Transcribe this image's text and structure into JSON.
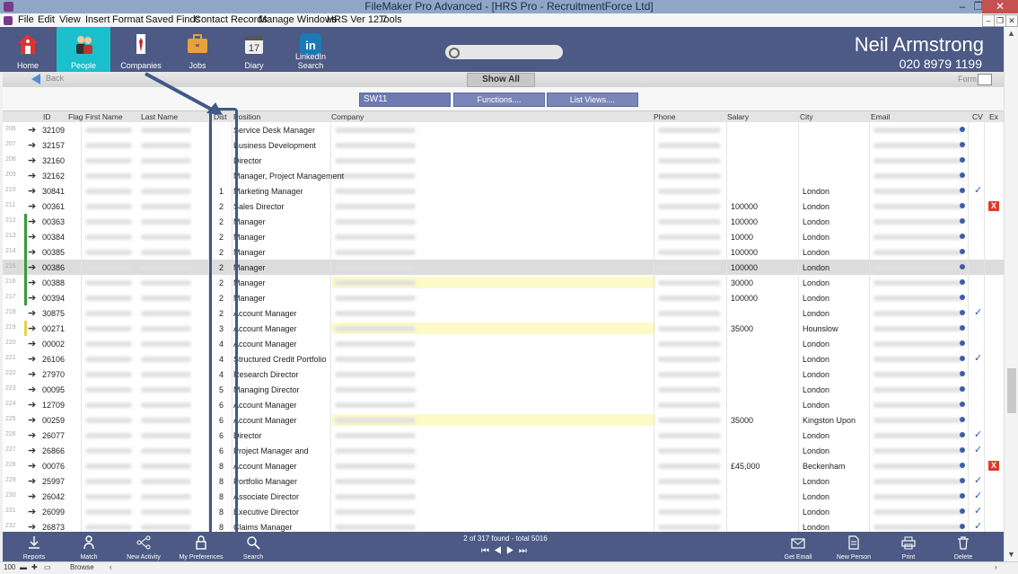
{
  "window": {
    "title": "FileMaker Pro Advanced - [HRS Pro - RecruitmentForce Ltd]",
    "controls": [
      "–",
      "❐",
      "✕"
    ]
  },
  "menu": [
    "File",
    "Edit",
    "View",
    "Insert",
    "Format",
    "Saved Finds",
    "Contact Records",
    "Manage Windows",
    "HRS Ver 12.7",
    "Tools"
  ],
  "nav": [
    {
      "label": "Home",
      "icon": "home-icon"
    },
    {
      "label": "People",
      "icon": "people-icon",
      "active": true
    },
    {
      "label": "Companies",
      "icon": "companies-icon"
    },
    {
      "label": "Jobs",
      "icon": "jobs-icon"
    },
    {
      "label": "Diary",
      "icon": "diary-icon"
    },
    {
      "label": "LinkedIn Search",
      "icon": "linkedin-icon"
    }
  ],
  "diary_day": "17",
  "user": {
    "name": "Neil Armstrong",
    "phone": "020 8979 1199"
  },
  "toolbar": {
    "back": "Back",
    "show_all": "Show All",
    "form": "Form"
  },
  "filters": {
    "sw": "SW11",
    "functions": "Functions....",
    "list_views": "List Views...."
  },
  "columns": [
    "ID",
    "Flag",
    "First Name",
    "Last Name",
    "Dist",
    "Position",
    "Company",
    "Phone",
    "Salary",
    "City",
    "Email",
    "CV",
    "Ex"
  ],
  "rows": [
    {
      "num": "206",
      "id": "32109",
      "dist": "",
      "position": "Service Desk Manager",
      "salary": "",
      "city": "",
      "cv": true,
      "check": false,
      "ex": false,
      "hl": false,
      "flag": ""
    },
    {
      "num": "207",
      "id": "32157",
      "dist": "",
      "position": "Business Development",
      "salary": "",
      "city": "",
      "cv": true,
      "check": false,
      "ex": false,
      "hl": false,
      "flag": ""
    },
    {
      "num": "208",
      "id": "32160",
      "dist": "",
      "position": "Director",
      "salary": "",
      "city": "",
      "cv": true,
      "check": false,
      "ex": false,
      "hl": false,
      "flag": ""
    },
    {
      "num": "209",
      "id": "32162",
      "dist": "",
      "position": "Manager, Project Management",
      "salary": "",
      "city": "",
      "cv": true,
      "check": false,
      "ex": false,
      "hl": false,
      "flag": ""
    },
    {
      "num": "210",
      "id": "30841",
      "dist": "1",
      "position": "Marketing Manager",
      "salary": "",
      "city": "London",
      "cv": true,
      "check": true,
      "ex": false,
      "hl": false,
      "flag": ""
    },
    {
      "num": "211",
      "id": "00361",
      "dist": "2",
      "position": "Sales Director",
      "salary": "100000",
      "city": "London",
      "cv": true,
      "check": false,
      "ex": true,
      "hl": false,
      "flag": ""
    },
    {
      "num": "212",
      "id": "00363",
      "dist": "2",
      "position": "Manager",
      "salary": "100000",
      "city": "London",
      "cv": true,
      "check": false,
      "ex": false,
      "hl": false,
      "flag": "green"
    },
    {
      "num": "213",
      "id": "00384",
      "dist": "2",
      "position": "Manager",
      "salary": "10000",
      "city": "London",
      "cv": true,
      "check": false,
      "ex": false,
      "hl": false,
      "flag": "green"
    },
    {
      "num": "214",
      "id": "00385",
      "dist": "2",
      "position": "Manager",
      "salary": "100000",
      "city": "London",
      "cv": true,
      "check": false,
      "ex": false,
      "hl": false,
      "flag": "green"
    },
    {
      "num": "215",
      "id": "00386",
      "dist": "2",
      "position": "Manager",
      "salary": "100000",
      "city": "London",
      "cv": true,
      "check": false,
      "ex": false,
      "hl": false,
      "flag": "green",
      "selected": true
    },
    {
      "num": "216",
      "id": "00388",
      "dist": "2",
      "position": "Manager",
      "salary": "30000",
      "city": "London",
      "cv": true,
      "check": false,
      "ex": false,
      "hl": true,
      "flag": "green"
    },
    {
      "num": "217",
      "id": "00394",
      "dist": "2",
      "position": "Manager",
      "salary": "100000",
      "city": "London",
      "cv": true,
      "check": false,
      "ex": false,
      "hl": false,
      "flag": "green"
    },
    {
      "num": "218",
      "id": "30875",
      "dist": "2",
      "position": "Account Manager",
      "salary": "",
      "city": "London",
      "cv": true,
      "check": true,
      "ex": false,
      "hl": false,
      "flag": ""
    },
    {
      "num": "219",
      "id": "00271",
      "dist": "3",
      "position": "Account Manager",
      "salary": "35000",
      "city": "Hounslow",
      "cv": true,
      "check": false,
      "ex": false,
      "hl": true,
      "flag": "yellow"
    },
    {
      "num": "220",
      "id": "00002",
      "dist": "4",
      "position": "Account Manager",
      "salary": "",
      "city": "London",
      "cv": true,
      "check": false,
      "ex": false,
      "hl": false,
      "flag": ""
    },
    {
      "num": "221",
      "id": "26106",
      "dist": "4",
      "position": "Structured Credit Portfolio",
      "salary": "",
      "city": "London",
      "cv": true,
      "check": true,
      "ex": false,
      "hl": false,
      "flag": ""
    },
    {
      "num": "222",
      "id": "27970",
      "dist": "4",
      "position": "Research Director",
      "salary": "",
      "city": "London",
      "cv": true,
      "check": false,
      "ex": false,
      "hl": false,
      "flag": ""
    },
    {
      "num": "223",
      "id": "00095",
      "dist": "5",
      "position": "Managing Director",
      "salary": "",
      "city": "London",
      "cv": true,
      "check": false,
      "ex": false,
      "hl": false,
      "flag": ""
    },
    {
      "num": "224",
      "id": "12709",
      "dist": "6",
      "position": "Account Manager",
      "salary": "",
      "city": "London",
      "cv": true,
      "check": false,
      "ex": false,
      "hl": false,
      "flag": ""
    },
    {
      "num": "225",
      "id": "00259",
      "dist": "6",
      "position": "Account Manager",
      "salary": "35000",
      "city": "Kingston Upon",
      "cv": true,
      "check": false,
      "ex": false,
      "hl": true,
      "flag": ""
    },
    {
      "num": "226",
      "id": "26077",
      "dist": "6",
      "position": "Director",
      "salary": "",
      "city": "London",
      "cv": true,
      "check": true,
      "ex": false,
      "hl": false,
      "flag": ""
    },
    {
      "num": "227",
      "id": "26866",
      "dist": "6",
      "position": "Project Manager and",
      "salary": "",
      "city": "London",
      "cv": true,
      "check": true,
      "ex": false,
      "hl": false,
      "flag": ""
    },
    {
      "num": "228",
      "id": "00076",
      "dist": "8",
      "position": "Account Manager",
      "salary": "£45,000",
      "city": "Beckenham",
      "cv": true,
      "check": false,
      "ex": true,
      "hl": false,
      "flag": ""
    },
    {
      "num": "229",
      "id": "25997",
      "dist": "8",
      "position": "Portfolio Manager",
      "salary": "",
      "city": "London",
      "cv": true,
      "check": true,
      "ex": false,
      "hl": false,
      "flag": ""
    },
    {
      "num": "230",
      "id": "26042",
      "dist": "8",
      "position": "Associate Director",
      "salary": "",
      "city": "London",
      "cv": true,
      "check": true,
      "ex": false,
      "hl": false,
      "flag": ""
    },
    {
      "num": "231",
      "id": "26099",
      "dist": "8",
      "position": "Executive Director",
      "salary": "",
      "city": "London",
      "cv": true,
      "check": true,
      "ex": false,
      "hl": false,
      "flag": ""
    },
    {
      "num": "232",
      "id": "26873",
      "dist": "8",
      "position": "Claims Manager",
      "salary": "",
      "city": "London",
      "cv": true,
      "check": true,
      "ex": false,
      "hl": false,
      "flag": ""
    }
  ],
  "footer": {
    "buttons": [
      "Reports",
      "Match",
      "New Activity",
      "My Preferences",
      "Search",
      "Get Email",
      "New Person",
      "Print",
      "Delete"
    ],
    "record_info": "2 of 317 found - total 5016",
    "nav_glyphs": "⏮◀▶⏭"
  },
  "status": {
    "zoom": "100",
    "mode": "Browse"
  },
  "colors": {
    "header": "#4c5a85",
    "active_tab": "#1ac0cc",
    "highlight": "#fdfac8",
    "ex": "#e0392b",
    "annotation": "#3f5a86"
  }
}
